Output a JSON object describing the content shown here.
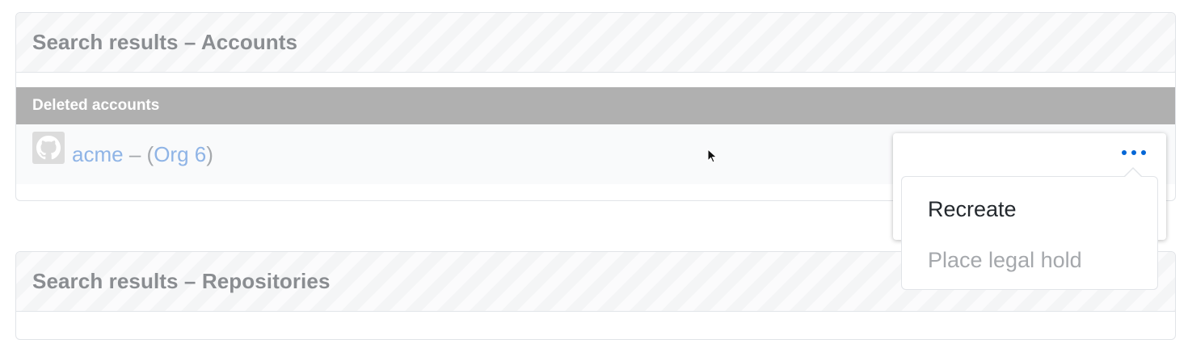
{
  "accounts_panel": {
    "title": "Search results – Accounts",
    "section_label": "Deleted accounts",
    "rows": [
      {
        "name": "acme",
        "separator": "–",
        "paren_open": "(",
        "org": "Org 6",
        "paren_close": ")"
      }
    ]
  },
  "repos_panel": {
    "title": "Search results – Repositories"
  },
  "menu": {
    "trigger_icon": "kebab-horizontal-icon",
    "items": [
      {
        "label": "Recreate",
        "enabled": true
      },
      {
        "label": "Place legal hold",
        "enabled": false
      }
    ]
  },
  "colors": {
    "link": "#8fb4e6",
    "menu_dots": "#0366d6",
    "section_bar": "#b0b0b0",
    "title_text": "#8a8d91"
  },
  "icons": {
    "avatar": "github-octocat-icon",
    "cursor": "mouse-pointer-icon"
  }
}
